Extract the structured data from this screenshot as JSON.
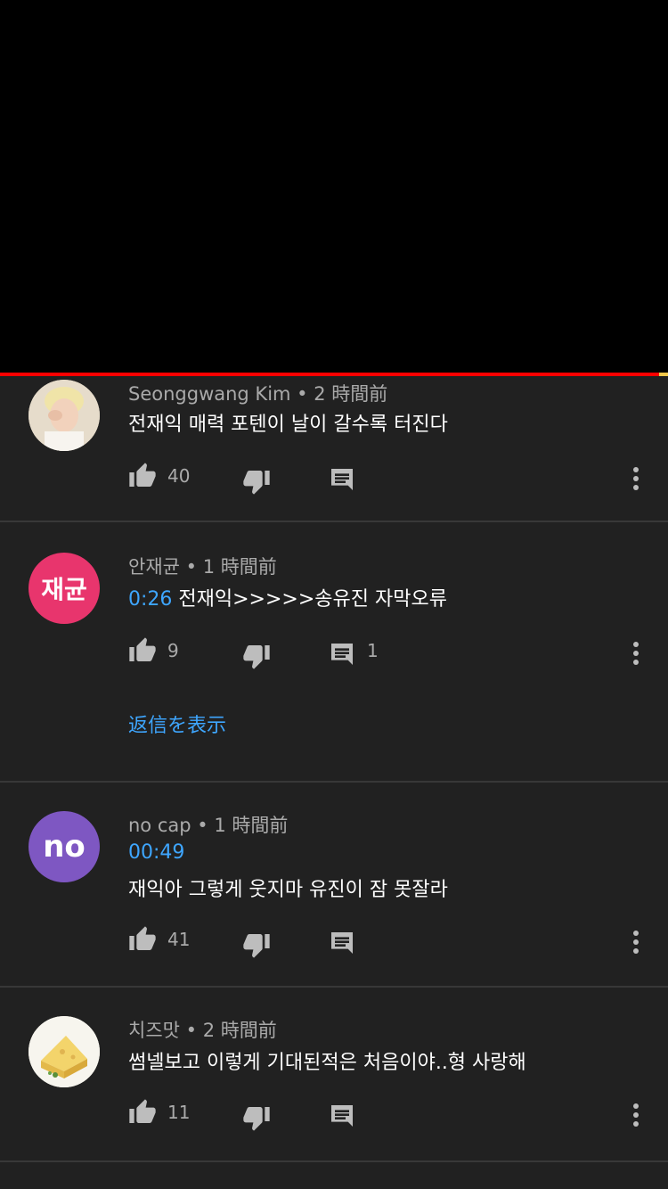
{
  "comments": [
    {
      "author": "Seonggwang Kim",
      "time": "2 時間前",
      "avatar_color": "#d9c9b0",
      "avatar_letters": "",
      "timestamp": "",
      "text": "전재익 매력 포텐이 날이 갈수록 터진다",
      "likes": "40",
      "replies": ""
    },
    {
      "author": "안재균",
      "time": "1 時間前",
      "avatar_color": "#e8356d",
      "avatar_letters": "재균",
      "timestamp": "0:26",
      "text": "전재익>>>>>송유진 자막오류",
      "likes": "9",
      "replies": "1",
      "show_replies": "返信を表示"
    },
    {
      "author": "no cap",
      "time": "1 時間前",
      "avatar_color": "#7e57c2",
      "avatar_letters": "no",
      "timestamp": "00:49",
      "text": "재익아 그렇게 웃지마 유진이 잠 못잘라",
      "likes": "41",
      "replies": ""
    },
    {
      "author": "치즈맛",
      "time": "2 時間前",
      "avatar_color": "#f5f1e6",
      "avatar_letters": "",
      "timestamp": "",
      "text": "썸넬보고 이렇게 기대된적은 처음이야..형 사랑해",
      "likes": "11",
      "replies": ""
    }
  ],
  "meta_separator": " • ",
  "colors": {
    "background": "#212121",
    "progress": "#ff0000",
    "link": "#3ea6ff",
    "secondary_text": "#aaaaaa"
  }
}
